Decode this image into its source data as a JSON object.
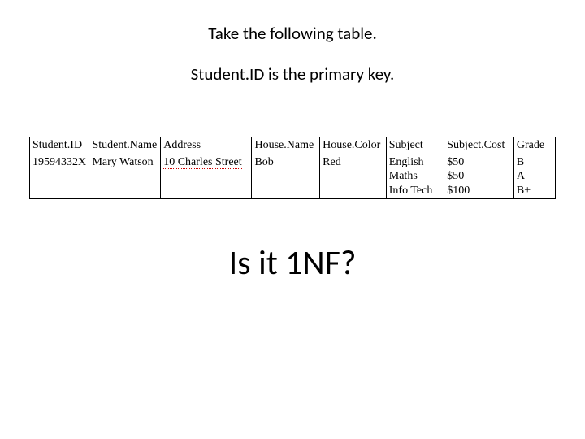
{
  "heading1": "Take the following table.",
  "heading2": "Student.ID is the primary key.",
  "table": {
    "headers": [
      "Student.ID",
      "Student.Name",
      "Address",
      "House.Name",
      "House.Color",
      "Subject",
      "Subject.Cost",
      "Grade"
    ],
    "row": {
      "student_id": "19594332X",
      "student_name": "Mary Watson",
      "address": "10 Charles Street",
      "house_name": "Bob",
      "house_color": "Red",
      "subjects": [
        "English",
        "Maths",
        "Info Tech"
      ],
      "costs": [
        "$50",
        "$50",
        "$100"
      ],
      "grades": [
        "B",
        "A",
        "B+"
      ]
    }
  },
  "question": "Is it 1NF?"
}
